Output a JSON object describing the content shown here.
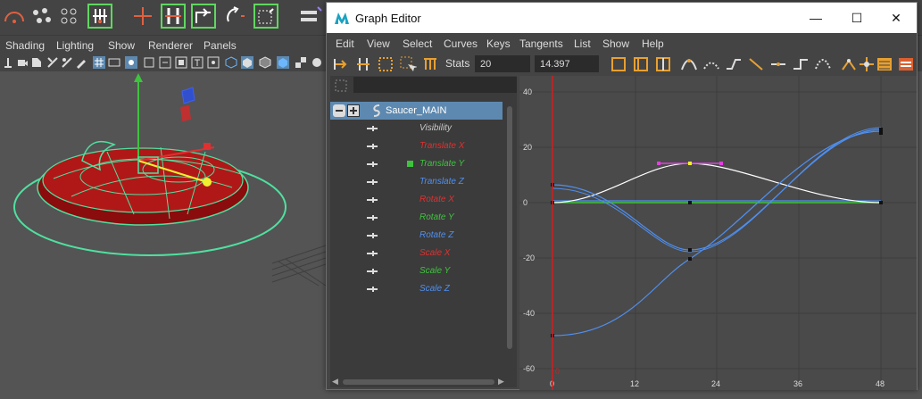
{
  "maya": {
    "menu": [
      "Shading",
      "Lighting",
      "Show",
      "Renderer",
      "Panels"
    ]
  },
  "graph_editor": {
    "title": "Graph Editor",
    "window_buttons": {
      "minimize": "—",
      "maximize": "☐",
      "close": "✕"
    },
    "menu": [
      "Edit",
      "View",
      "Select",
      "Curves",
      "Keys",
      "Tangents",
      "List",
      "Show",
      "Help"
    ],
    "stats_label": "Stats",
    "stats_value1": "20",
    "stats_value2": "14.397",
    "outliner": {
      "root": "Saucer_MAIN",
      "channels": [
        {
          "label": "Visibility",
          "color": "#c8c8c8"
        },
        {
          "label": "Translate X",
          "color": "#e03030"
        },
        {
          "label": "Translate Y",
          "color": "#3ec33e"
        },
        {
          "label": "Translate Z",
          "color": "#4f8ff0"
        },
        {
          "label": "Rotate X",
          "color": "#e03030"
        },
        {
          "label": "Rotate Y",
          "color": "#3ec33e"
        },
        {
          "label": "Rotate Z",
          "color": "#4f8ff0"
        },
        {
          "label": "Scale X",
          "color": "#e03030"
        },
        {
          "label": "Scale Y",
          "color": "#3ec33e"
        },
        {
          "label": "Scale Z",
          "color": "#4f8ff0"
        }
      ]
    },
    "graph": {
      "x_ticks": [
        "0",
        "12",
        "24",
        "36",
        "48"
      ],
      "y_ticks": [
        "40",
        "20",
        "0",
        "-20",
        "-40",
        "-60"
      ],
      "current_time": "0"
    }
  }
}
